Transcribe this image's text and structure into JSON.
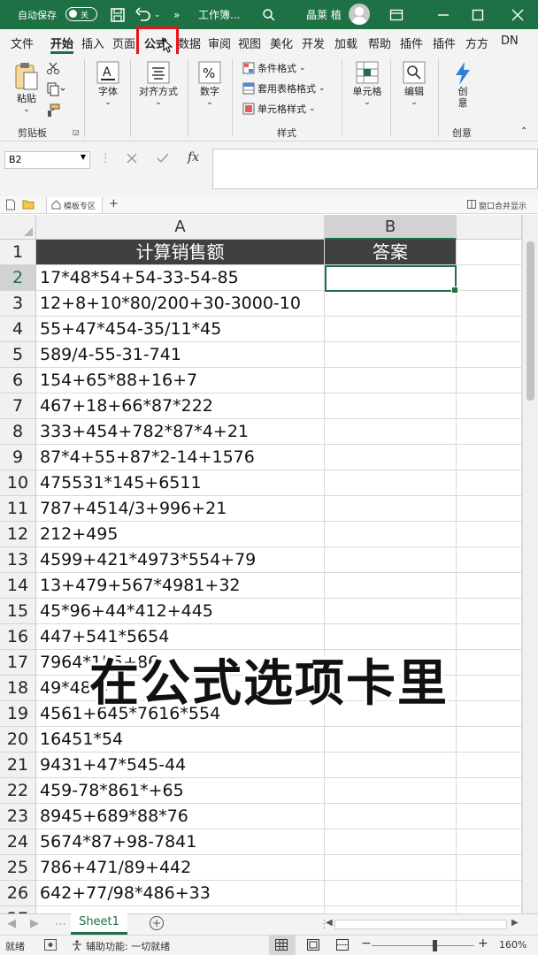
{
  "titlebar": {
    "autosave_label": "自动保存",
    "autosave_state": "关",
    "doc_name": "工作簿...",
    "user_name": "晶莱 植",
    "overflow": "»"
  },
  "ribbon_tabs": [
    "文件",
    "开始",
    "插入",
    "页面",
    "公式",
    "数据",
    "审阅",
    "视图",
    "美化",
    "开发",
    "加载",
    "帮助",
    "插件",
    "插件",
    "方方",
    "DN"
  ],
  "ribbon": {
    "paste": "粘贴",
    "clipboard_group": "剪贴板",
    "font": "字体",
    "align": "对齐方式",
    "number": "数字",
    "cond_format": "条件格式",
    "table_format": "套用表格格式",
    "cell_style": "单元格样式",
    "style_group": "样式",
    "cells": "单元格",
    "edit": "编辑",
    "create": "创\n意",
    "create_group": "创意"
  },
  "formula_bar": {
    "name_box": "B2",
    "fx": "fx",
    "value": ""
  },
  "workbook_strip": {
    "template": "模板专区",
    "window_merge": "窗口合并显示"
  },
  "sheet": {
    "col_a": "A",
    "col_b": "B",
    "header_a": "计算销售额",
    "header_b": "答案",
    "rows": [
      {
        "n": "1",
        "a": "计算销售额",
        "b": "答案"
      },
      {
        "n": "2",
        "a": "17*48*54+54-33-54-85",
        "b": ""
      },
      {
        "n": "3",
        "a": "12+8+10*80/200+30-3000-10",
        "b": ""
      },
      {
        "n": "4",
        "a": "55+47*454-35/11*45",
        "b": ""
      },
      {
        "n": "5",
        "a": "589/4-55-31-741",
        "b": ""
      },
      {
        "n": "6",
        "a": "154+65*88+16+7",
        "b": ""
      },
      {
        "n": "7",
        "a": "467+18+66*87*222",
        "b": ""
      },
      {
        "n": "8",
        "a": "333+454+782*87*4+21",
        "b": ""
      },
      {
        "n": "9",
        "a": "87*4+55+87*2-14+1576",
        "b": ""
      },
      {
        "n": "10",
        "a": "475531*145+6511",
        "b": ""
      },
      {
        "n": "11",
        "a": "787+4514/3+996+21",
        "b": ""
      },
      {
        "n": "12",
        "a": "212+495",
        "b": ""
      },
      {
        "n": "13",
        "a": "4599+421*4973*554+79",
        "b": ""
      },
      {
        "n": "14",
        "a": "13+479+567*4981+32",
        "b": ""
      },
      {
        "n": "15",
        "a": "45*96+44*412+445",
        "b": ""
      },
      {
        "n": "16",
        "a": "447+541*5654",
        "b": ""
      },
      {
        "n": "17",
        "a": "7964*155+86",
        "b": ""
      },
      {
        "n": "18",
        "a": "49*48-4",
        "b": ""
      },
      {
        "n": "19",
        "a": "4561+645*7616*554",
        "b": ""
      },
      {
        "n": "20",
        "a": "16451*54",
        "b": ""
      },
      {
        "n": "21",
        "a": "9431+47*545-44",
        "b": ""
      },
      {
        "n": "22",
        "a": "459-78*861*+65",
        "b": ""
      },
      {
        "n": "23",
        "a": "8945+689*88*76",
        "b": ""
      },
      {
        "n": "24",
        "a": "5674*87+98-7841",
        "b": ""
      },
      {
        "n": "25",
        "a": "786+471/89+442",
        "b": ""
      },
      {
        "n": "26",
        "a": "642+77/98*486+33",
        "b": ""
      },
      {
        "n": "27",
        "a": "",
        "b": ""
      }
    ]
  },
  "subtitle": "在公式选项卡里",
  "sheet_tab": "Sheet1",
  "status": {
    "ready": "就绪",
    "accessibility": "辅助功能: 一切就绪",
    "zoom": "160%"
  },
  "colors": {
    "excel_green": "#1e7145",
    "header_fill": "#404040",
    "highlight_box": "#e8141b"
  }
}
